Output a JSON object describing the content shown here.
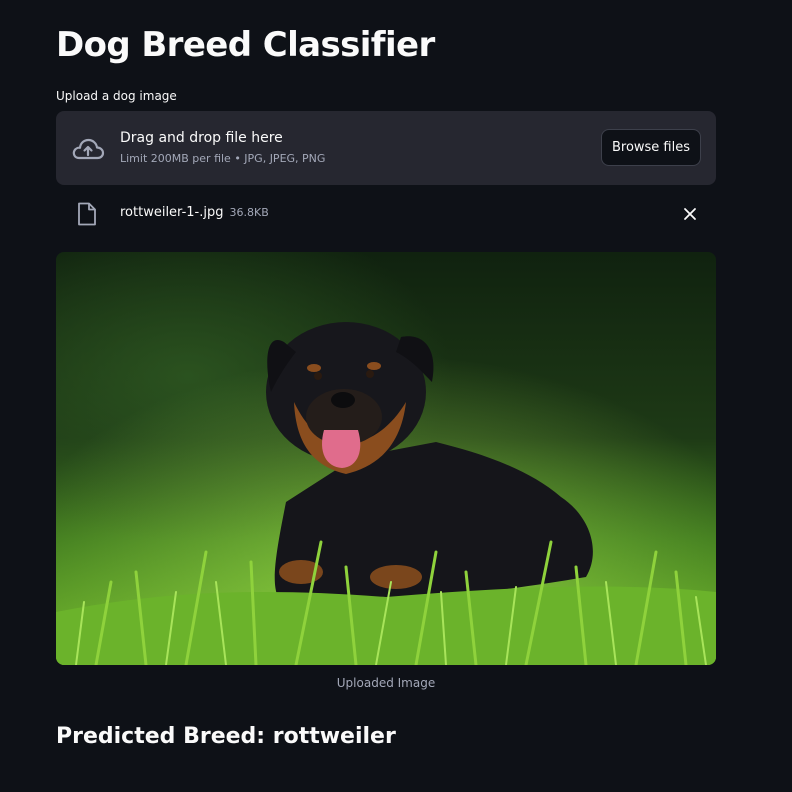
{
  "app": {
    "title": "Dog Breed Classifier"
  },
  "uploader": {
    "label": "Upload a dog image",
    "drag_text": "Drag and drop file here",
    "limit_text": "Limit 200MB per file • JPG, JPEG, PNG",
    "browse_label": "Browse files",
    "upload_icon": "cloud-upload-icon"
  },
  "file": {
    "name": "rottweiler-1-.jpg",
    "size": "36.8KB",
    "file_icon": "file-icon",
    "remove_icon": "close-icon"
  },
  "image": {
    "caption": "Uploaded Image",
    "alt": "rottweiler dog lying in grass"
  },
  "result": {
    "prefix": "Predicted Breed: ",
    "breed": "rottweiler"
  },
  "colors": {
    "background": "#0e1117",
    "panel": "#262730",
    "text": "#fafafa",
    "muted": "#a3a8b8",
    "border": "#3d404b"
  }
}
